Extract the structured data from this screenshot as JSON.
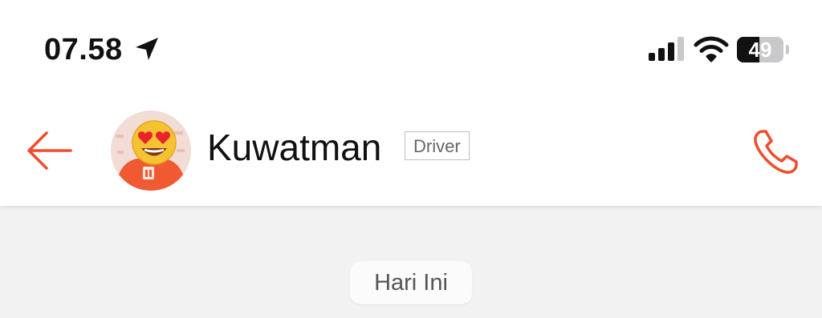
{
  "status_bar": {
    "time": "07.58",
    "battery_percent": 49,
    "battery_label": "49"
  },
  "header": {
    "contact_name": "Kuwatman",
    "role_badge": "Driver"
  },
  "chat": {
    "date_separator": "Hari Ini"
  },
  "icons": {
    "back": "arrow-left-icon",
    "call": "phone-icon",
    "location": "location-arrow-icon",
    "signal": "cellular-signal-icon",
    "wifi": "wifi-icon",
    "battery": "battery-icon"
  },
  "colors": {
    "accent": "#ee4d2d",
    "header_bg": "#ffffff",
    "chat_bg": "#f2f2f2",
    "avatar_shirt": "#ef5a33"
  }
}
